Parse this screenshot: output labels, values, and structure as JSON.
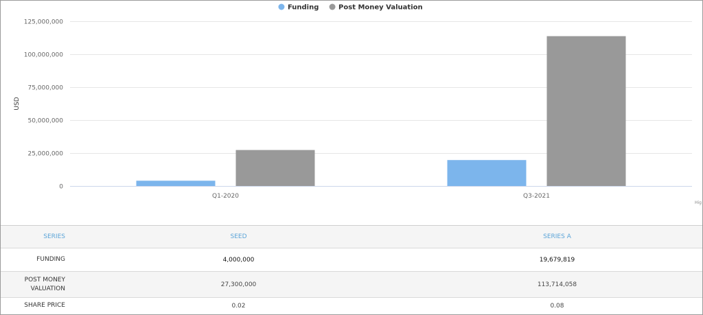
{
  "chart_data": {
    "type": "bar",
    "categories": [
      "Q1-2020",
      "Q3-2021"
    ],
    "series": [
      {
        "name": "Funding",
        "values": [
          4000000,
          19679819
        ],
        "color": "#7cb5ec"
      },
      {
        "name": "Post Money Valuation",
        "values": [
          27300000,
          113714058
        ],
        "color": "#999999"
      }
    ],
    "ylabel": "USD",
    "ylim": [
      0,
      125000000
    ],
    "yticks": [
      0,
      25000000,
      50000000,
      75000000,
      100000000,
      125000000
    ],
    "ytick_labels": [
      "0",
      "25,000,000",
      "50,000,000",
      "75,000,000",
      "100,000,000",
      "125,000,000"
    ],
    "grid": true,
    "legend": "top-center",
    "credits": "Hig"
  },
  "table": {
    "header": {
      "label": "SERIES",
      "col1": "SEED",
      "col2": "SERIES A"
    },
    "rows": [
      {
        "label_line1": "FUNDING",
        "label_line2": "",
        "col1": "4,000,000",
        "col2": "19,679,819"
      },
      {
        "label_line1": "POST MONEY",
        "label_line2": "VALUATION",
        "col1": "27,300,000",
        "col2": "113,714,058"
      },
      {
        "label_line1": "SHARE PRICE",
        "label_line2": "",
        "col1": "0.02",
        "col2": "0.08"
      }
    ]
  }
}
